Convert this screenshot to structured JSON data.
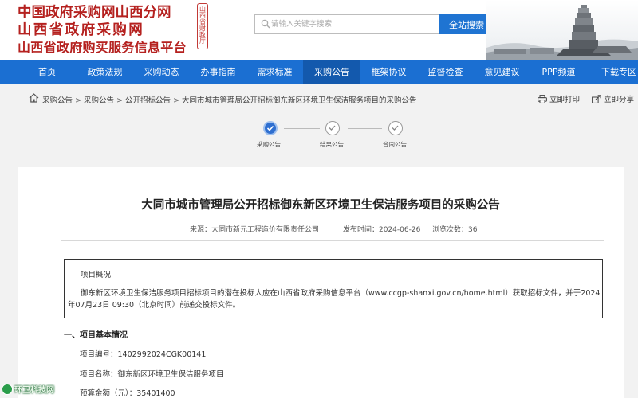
{
  "header": {
    "logo_lines": [
      "中国政府采购网山西分网",
      "山西省政府采购网",
      "山西省政府购买服务信息平台"
    ],
    "seal_text": "山西省财政厅",
    "search_placeholder": "请输入关键字搜索",
    "search_button": "全站搜索"
  },
  "nav": {
    "items": [
      "首页",
      "政策法规",
      "采购动态",
      "办事指南",
      "需求标准",
      "采购公告",
      "框架协议",
      "监督检查",
      "意见建议",
      "PPP频道",
      "下载专区"
    ],
    "active": "采购公告"
  },
  "breadcrumb": {
    "items": [
      "采购公告",
      "采购公告",
      "公开招标公告",
      "大同市城市管理局公开招标御东新区环境卫生保洁服务项目的采购公告"
    ],
    "print_label": "立即打印",
    "share_label": "立即分享"
  },
  "steps": [
    {
      "label": "采购公告",
      "state": "done"
    },
    {
      "label": "结果公告",
      "state": "todo"
    },
    {
      "label": "合同公告",
      "state": "todo"
    }
  ],
  "article": {
    "title": "大同市城市管理局公开招标御东新区环境卫生保洁服务项目的采购公告",
    "source": "来源：大同市新元工程造价有限责任公司",
    "publish_time": "发布时间：2024-06-26",
    "views": "浏览次数：36",
    "overview_label": "项目概况",
    "overview_body": "御东新区环境卫生保洁服务项目招标项目的潜在投标人应在山西省政府采购信息平台（www.ccgp-shanxi.gov.cn/home.html）获取招标文件，并于2024年07月23日 09:30（北京时间）前递交投标文件。",
    "section_title": "一、项目基本情况",
    "project_no": "项目编号：1402992024CGK00141",
    "project_name": "项目名称：御东新区环境卫生保洁服务项目",
    "budget": "预算金额（元）：35401400"
  },
  "watermark": "环卫科技网",
  "colors": {
    "brand_red": "#b5211f",
    "nav_blue": "#1b6fd2",
    "nav_active": "#1359ad",
    "search_button": "#1f74d2",
    "step_done": "#2f6fd0"
  }
}
